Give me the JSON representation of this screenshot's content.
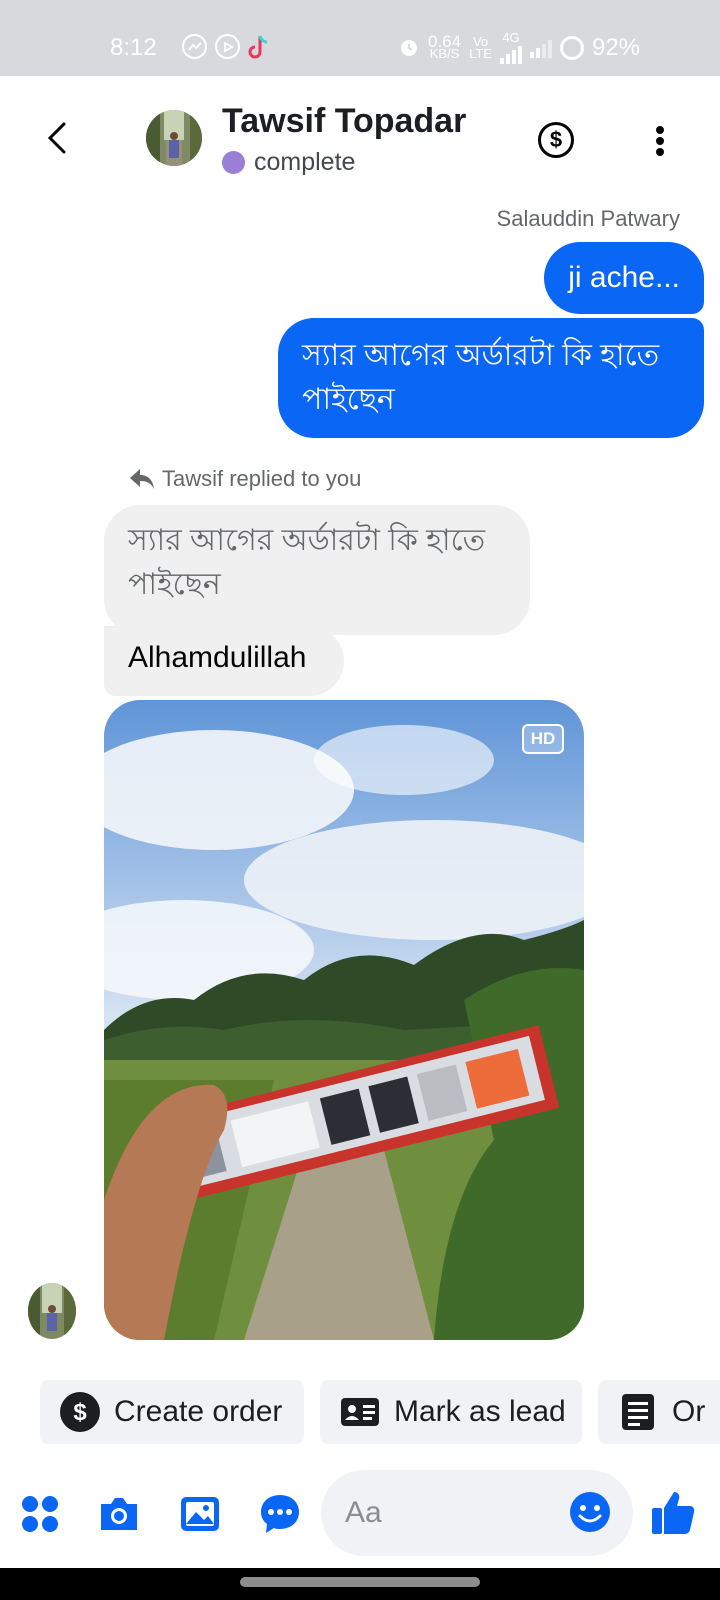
{
  "status_bar": {
    "time": "8:12",
    "speed_value": "0.64",
    "speed_unit": "KB/S",
    "volte_top": "Vo",
    "volte_bottom": "LTE",
    "network": "4G",
    "battery": "92%",
    "left_icons": [
      "messenger-icon",
      "location-arrow-icon",
      "tiktok-icon"
    ],
    "right_icons": [
      "alarm-icon",
      "signal-icon",
      "battery-icon"
    ]
  },
  "header": {
    "contact_name": "Tawsif Topadar",
    "status_label": "complete",
    "status_color": "#9b7fd6",
    "dollar_symbol": "$"
  },
  "messages": {
    "sender_label": "Salauddin Patwary",
    "outgoing_1": "ji ache...",
    "outgoing_2": "স্যার আগের অর্ডারটা কি হাতে পাইছেন",
    "reply_indicator": "Tawsif replied to you",
    "quoted_text": "স্যার আগের অর্ডারটা কি হাতে পাইছেন",
    "reply_text": "Alhamdulillah",
    "photo_badge": "HD"
  },
  "quick_actions": [
    {
      "label": "Create order",
      "icon": "dollar-circle-icon"
    },
    {
      "label": "Mark as lead",
      "icon": "contact-card-icon"
    },
    {
      "label": "Or",
      "icon": "order-list-icon"
    }
  ],
  "composer": {
    "placeholder": "Aa",
    "icons": [
      "apps-icon",
      "camera-icon",
      "gallery-icon",
      "chat-bubble-icon",
      "emoji-icon",
      "thumbs-up-icon"
    ]
  },
  "colors": {
    "accent": "#0a66f5",
    "outgoing_bubble": "#0a66f5",
    "incoming_bubble": "#f0f0f0",
    "status_bar": "#d8d9dd"
  }
}
